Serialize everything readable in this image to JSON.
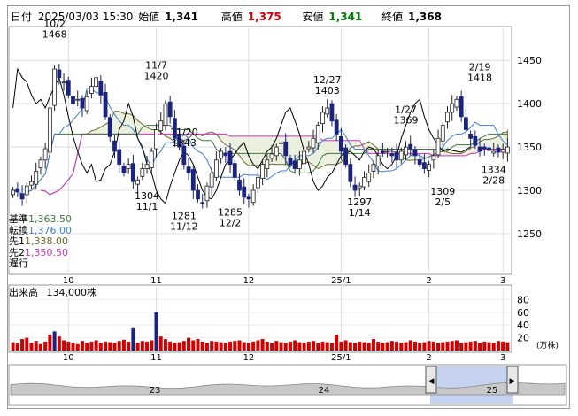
{
  "header": {
    "date_label": "日付",
    "date_value": "2025/03/03 15:30",
    "open_label": "始値",
    "open_value": "1,341",
    "high_label": "高値",
    "high_value": "1,375",
    "low_label": "安値",
    "low_value": "1,341",
    "close_label": "終値",
    "close_value": "1,368"
  },
  "indicators": [
    {
      "label": "基準",
      "value": "1,363.50",
      "color": "#3a7a3a"
    },
    {
      "label": "転換",
      "value": "1,376.00",
      "color": "#3b7fd9"
    },
    {
      "label": "先1",
      "value": "1,338.00",
      "color": "#6b6b2a"
    },
    {
      "label": "先2",
      "value": "1,350.50",
      "color": "#d030c0"
    },
    {
      "label": "遅行",
      "value": "",
      "color": "#000000"
    }
  ],
  "volume": {
    "label": "出来高",
    "value": "134,000株",
    "ticks": [
      "80",
      "60",
      "40",
      "20"
    ],
    "unit": "(万株)"
  },
  "colors": {
    "up": "#d40000",
    "down": "#1a237e",
    "kijun": "#3a7a3a",
    "tenkan": "#3b7fd9",
    "senkou1": "#6b6b2a",
    "senkou2": "#d030c0",
    "chikou": "#000000",
    "volume": "#d40000",
    "volume_spike": "#1a237e"
  },
  "overview": {
    "labels": [
      "23",
      "24",
      "25"
    ],
    "left_arrow": "◀",
    "right_arrow": "▶"
  },
  "chart_data": {
    "type": "candlestick",
    "x_tick_labels": [
      "10",
      "11",
      "12",
      "25/1",
      "2",
      "3"
    ],
    "y_ticks": [
      1250,
      1300,
      1350,
      1400,
      1450
    ],
    "ylim": [
      1205,
      1487
    ],
    "annotations": [
      {
        "date": "10/2",
        "value": 1468,
        "text_date": "10/2",
        "text_value": "1468"
      },
      {
        "date": "11/7",
        "value": 1420,
        "text_date": "11/7",
        "text_value": "1420"
      },
      {
        "date": "11/1",
        "value": 1304,
        "text_date": "11/1",
        "text_value": "1304"
      },
      {
        "date": "11/20",
        "value": 1343,
        "text_date": "11/20",
        "text_value": "1343"
      },
      {
        "date": "11/12",
        "value": 1281,
        "text_date": "11/12",
        "text_value": "1281"
      },
      {
        "date": "12/2",
        "value": 1285,
        "text_date": "12/2",
        "text_value": "1285"
      },
      {
        "date": "12/27",
        "value": 1403,
        "text_date": "12/27",
        "text_value": "1403"
      },
      {
        "date": "1/14",
        "value": 1297,
        "text_date": "1/14",
        "text_value": "1297"
      },
      {
        "date": "1/27",
        "value": 1369,
        "text_date": "1/27",
        "text_value": "1369"
      },
      {
        "date": "2/5",
        "value": 1309,
        "text_date": "2/5",
        "text_value": "1309"
      },
      {
        "date": "2/19",
        "value": 1418,
        "text_date": "2/19",
        "text_value": "1418"
      },
      {
        "date": "2/28",
        "value": 1334,
        "text_date": "2/28",
        "text_value": "1334"
      }
    ],
    "closes": [
      1300,
      1298,
      1290,
      1305,
      1310,
      1322,
      1335,
      1348,
      1395,
      1440,
      1430,
      1425,
      1410,
      1400,
      1405,
      1395,
      1408,
      1420,
      1430,
      1410,
      1385,
      1362,
      1345,
      1330,
      1320,
      1330,
      1310,
      1312,
      1325,
      1330,
      1345,
      1370,
      1380,
      1400,
      1385,
      1360,
      1350,
      1330,
      1320,
      1300,
      1290,
      1285,
      1305,
      1320,
      1335,
      1345,
      1340,
      1330,
      1315,
      1300,
      1292,
      1290,
      1300,
      1315,
      1330,
      1335,
      1342,
      1350,
      1355,
      1340,
      1330,
      1325,
      1335,
      1345,
      1350,
      1360,
      1375,
      1390,
      1395,
      1380,
      1365,
      1345,
      1330,
      1310,
      1300,
      1305,
      1315,
      1320,
      1330,
      1340,
      1343,
      1345,
      1340,
      1335,
      1345,
      1350,
      1348,
      1340,
      1330,
      1325,
      1330,
      1340,
      1360,
      1375,
      1390,
      1400,
      1405,
      1385,
      1370,
      1360,
      1352,
      1345,
      1348,
      1346,
      1345,
      1344,
      1347,
      1350
    ],
    "volume": [
      13,
      11,
      18,
      20,
      12,
      15,
      10,
      14,
      25,
      30,
      22,
      16,
      14,
      12,
      10,
      15,
      12,
      14,
      16,
      12,
      14,
      13,
      12,
      15,
      17,
      14,
      35,
      12,
      15,
      14,
      16,
      60,
      22,
      18,
      14,
      12,
      13,
      15,
      20,
      16,
      18,
      14,
      12,
      15,
      14,
      13,
      12,
      14,
      15,
      16,
      13,
      12,
      14,
      16,
      18,
      14,
      12,
      15,
      13,
      12,
      14,
      16,
      13,
      12,
      14,
      15,
      12,
      14,
      13,
      12,
      25,
      14,
      16,
      13,
      12,
      14,
      13,
      12,
      18,
      14,
      12,
      13,
      15,
      14,
      12,
      13,
      16,
      14,
      12,
      13,
      15,
      14,
      12,
      13,
      14,
      15,
      16,
      12,
      13,
      14,
      15,
      12,
      14,
      13,
      12,
      15,
      14,
      13
    ]
  }
}
